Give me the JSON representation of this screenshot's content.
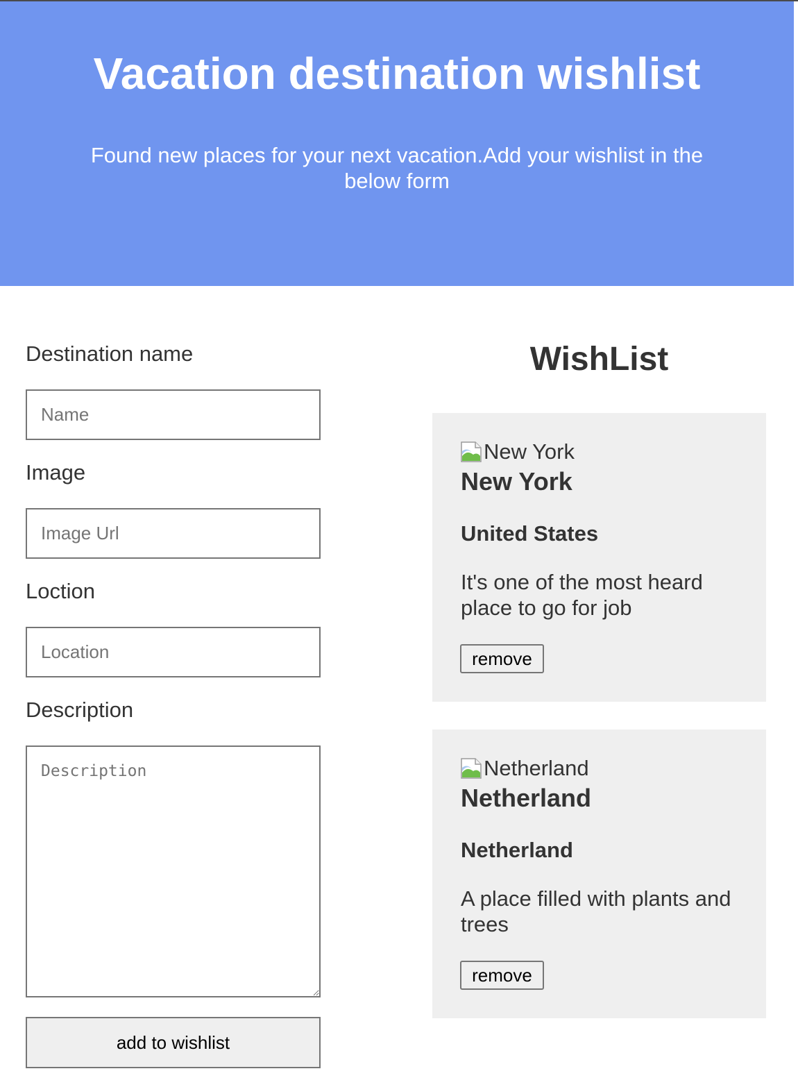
{
  "hero": {
    "title": "Vacation destination wishlist",
    "subtitle": "Found new places for your next vacation.Add your wishlist in the below form",
    "background_color": "#7095ef"
  },
  "form": {
    "name_label": "Destination name",
    "name_placeholder": "Name",
    "name_value": "",
    "image_label": "Image",
    "image_placeholder": "Image Url",
    "image_value": "",
    "location_label": "Loction",
    "location_placeholder": "Location",
    "location_value": "",
    "description_label": "Description",
    "description_placeholder": "Description",
    "description_value": "",
    "submit_label": "add to wishlist"
  },
  "wishlist": {
    "title": "WishList",
    "items": [
      {
        "image_alt": "New York",
        "name": "New York",
        "location": "United States",
        "description": "It's one of the most heard place to go for job",
        "remove_label": "remove"
      },
      {
        "image_alt": "Netherland",
        "name": "Netherland",
        "location": "Netherland",
        "description": "A place filled with plants and trees",
        "remove_label": "remove"
      }
    ]
  }
}
